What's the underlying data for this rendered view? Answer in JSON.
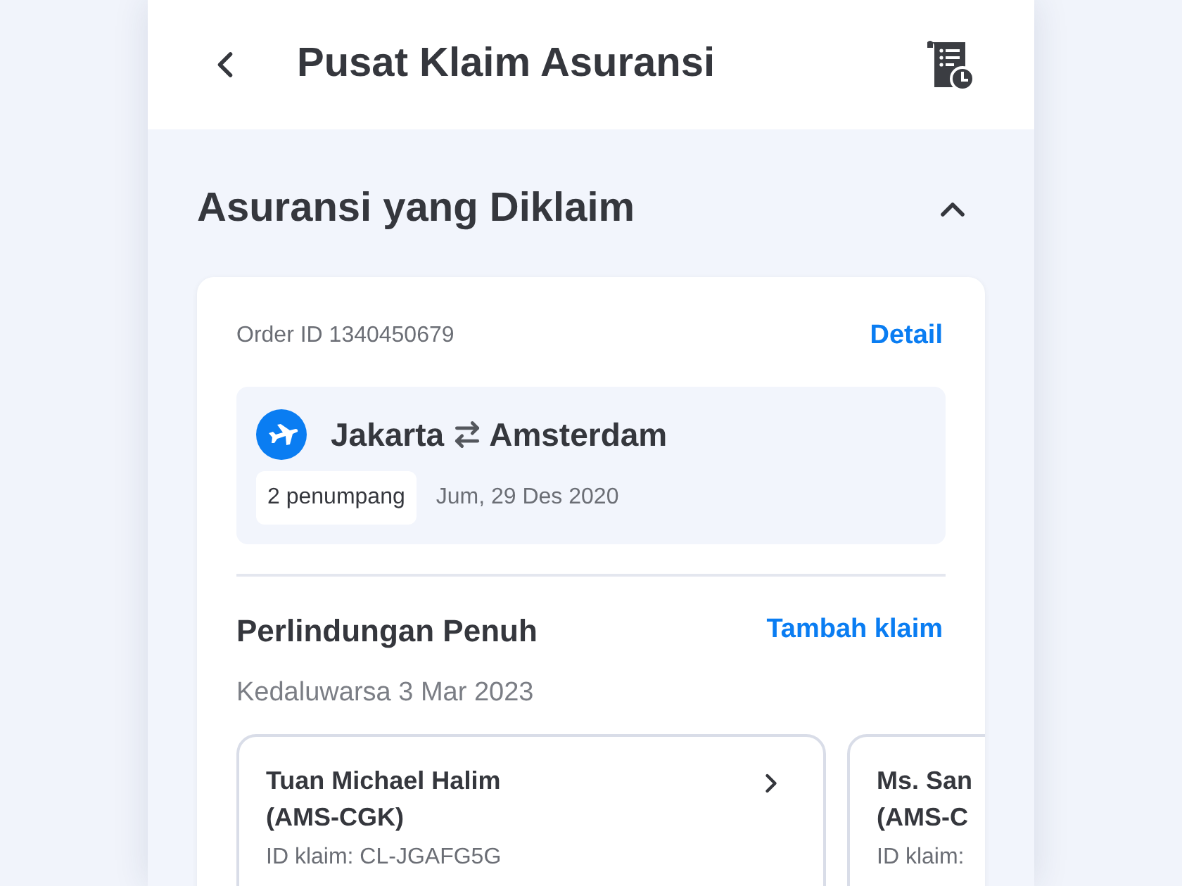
{
  "header": {
    "title": "Pusat Klaim Asuransi"
  },
  "section": {
    "title": "Asuransi yang Diklaim",
    "expanded": true
  },
  "order": {
    "order_id": "Order ID 1340450679",
    "detail_link": "Detail",
    "origin": "Jakarta",
    "destination": "Amsterdam",
    "passengers": "2 penumpang",
    "date": "Jum, 29 Des 2020"
  },
  "coverage": {
    "title": "Perlindungan Penuh",
    "add_claim_link": "Tambah klaim",
    "expiry": "Kedaluwarsa 3 Mar 2023"
  },
  "claims": [
    {
      "name": "Tuan Michael Halim",
      "route": "(AMS-CGK)",
      "claim_id": "ID klaim: CL-JGAFG5G",
      "arrow_visible": true
    },
    {
      "name": "Ms. San",
      "route": "(AMS-C",
      "claim_id": "ID klaim:",
      "arrow_visible": false
    }
  ]
}
